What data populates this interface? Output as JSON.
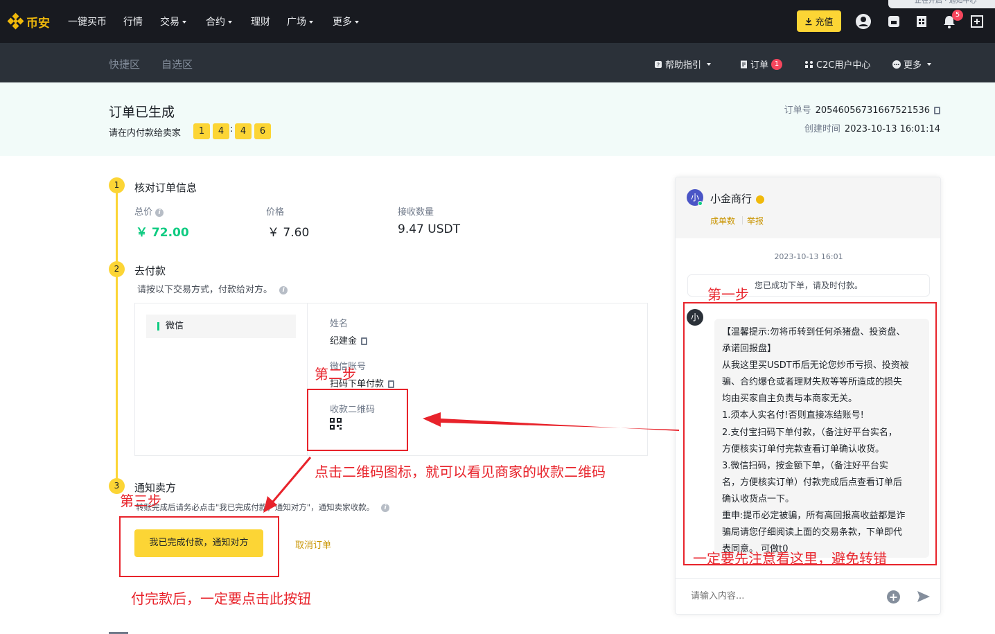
{
  "brand": {
    "logo_text": "币安",
    "accent": "#f0b90b"
  },
  "topnav": {
    "items": [
      {
        "label": "一键买币",
        "dropdown": false
      },
      {
        "label": "行情",
        "dropdown": false
      },
      {
        "label": "交易",
        "dropdown": true
      },
      {
        "label": "合约",
        "dropdown": true
      },
      {
        "label": "理财",
        "dropdown": false
      },
      {
        "label": "广场",
        "dropdown": true
      },
      {
        "label": "更多",
        "dropdown": true
      }
    ],
    "deposit_label": "充值",
    "notification_count": "5",
    "icons": [
      "user-icon",
      "wallet-icon",
      "orders-icon",
      "bell-icon",
      "download-icon"
    ],
    "corner_status": "正在开启 · 通知中心"
  },
  "subnav": {
    "left": [
      "快捷区",
      "自选区"
    ],
    "right": [
      {
        "label": "帮助指引",
        "icon": "help-icon",
        "dropdown": true
      },
      {
        "label": "订单",
        "icon": "order-icon",
        "badge": "1"
      },
      {
        "label": "C2C用户中心",
        "icon": "user-center-icon"
      },
      {
        "label": "更多",
        "icon": "more-icon",
        "dropdown": true
      }
    ]
  },
  "order": {
    "title": "订单已生成",
    "pay_prompt": "请在内付款给卖家",
    "timer_digits": [
      "1",
      "4",
      "4",
      "6"
    ],
    "timer_sep": ":",
    "order_no_label": "订单号",
    "order_no": "20546056731667521536",
    "created_label": "创建时间",
    "created_at": "2023-10-13 16:01:14"
  },
  "steps": [
    {
      "num": "1",
      "title": "核对订单信息"
    },
    {
      "num": "2",
      "title": "去付款",
      "desc": "请按以下交易方式，付款给对方。"
    },
    {
      "num": "3",
      "title": "通知卖方",
      "desc": "转账完成后请务必点击\"我已完成付款，通知对方\"，通知卖家收款。"
    }
  ],
  "summary": {
    "total_label": "总价",
    "total": "￥ 72.00",
    "price_label": "价格",
    "price": "￥ 7.60",
    "qty_label": "接收数量",
    "qty": "9.47 USDT"
  },
  "payment": {
    "method": "微信",
    "name_label": "姓名",
    "name": "纪建金",
    "account_label": "微信账号",
    "account": "扫码下单付款",
    "qr_label": "收款二维码"
  },
  "actions": {
    "confirm": "我已完成付款，通知对方",
    "cancel": "取消订单"
  },
  "chat": {
    "merchant": "小金商行",
    "avatar_char": "小",
    "stats": [
      "成单数",
      "举报"
    ],
    "time": "2023-10-13 16:01",
    "system_msg": "您已成功下单，请及时付款。",
    "message_lines": [
      "【温馨提示:勿将币转到任何杀猪盘、投资盘、",
      "承诺回报盘】",
      "从我这里买USDT币后无论您炒币亏损、投资被",
      "骗、合约爆仓或者理财失败等等所造成的损失",
      "均由买家自主负责与本商家无关。",
      "1.须本人实名付!否则直接冻结账号!",
      "2.支付宝扫码下单付款，（备注好平台实名，",
      "方便核实订单付完款查看订单确认收货。",
      "3.微信扫码，按金额下单，（备注好平台实",
      "名，方便核实订单）付款完成后点查看订单后",
      "确认收货点一下。",
      "重申:提币必定被骗，所有高回报高收益都是诈",
      "骗局请您仔细阅读上面的交易条款，下单即代",
      "表同意。 可做t0"
    ],
    "input_placeholder": "请输入内容..."
  },
  "annotations": {
    "step1": "第一步",
    "step2": "第二步",
    "step3": "第三步",
    "qr_hint": "点击二维码图标，就可以看见商家的收款二维码",
    "chat_hint": "一定要先注意看这里，避免转错",
    "button_hint": "付完款后，一定要点击此按钮",
    "color": "#e8232b"
  }
}
